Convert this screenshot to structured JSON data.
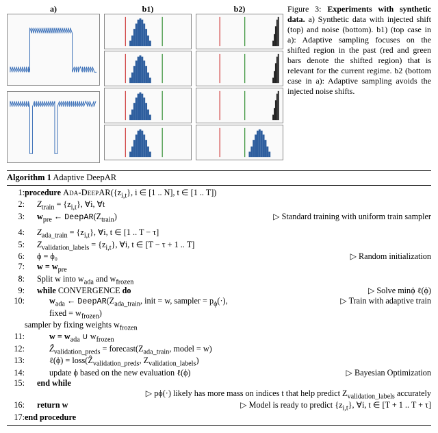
{
  "figure": {
    "labels": {
      "a": "a)",
      "b1": "b1)",
      "b2": "b2)"
    },
    "caption_prefix": "Figure 3:",
    "caption_title": "Experiments with synthetic data.",
    "caption_body": " a) Synthetic data with injected shift (top) and noise (bottom). b1) (top case in a): Adaptive sampling focuses on the shifted region in the past (red and green bars denote the shifted region) that is relevant for the current regime. b2 (bottom case in a): Adaptive sampling avoids the injected noise shifts."
  },
  "algorithm": {
    "title_prefix": "Algorithm 1",
    "title_name": "Adaptive DeepAR",
    "lines": {
      "l1_kw": "procedure",
      "l1_name": "Ada-DeepAR",
      "l1_args": "({z",
      "l1_args2": "i,t",
      "l1_args3": "},  i ∈ [1 .. N],  t ∈ [1 .. T])",
      "l2": "Z",
      "l2b": "train",
      "l2c": " = {z",
      "l2d": "i,t",
      "l2e": "}, ∀i,  ∀t",
      "l3a": "w",
      "l3b": "pre",
      "l3c": " ← ",
      "l3d": "DeepAR",
      "l3e": "(Z",
      "l3f": "train",
      "l3g": ")",
      "c3": "▷ Standard training with uniform train sampler",
      "l4a": "Z",
      "l4b": "ada_train",
      "l4c": " = {z",
      "l4d": "i,t",
      "l4e": "},  ∀i,  t ∈ [1 .. T − τ]",
      "l5a": "Z",
      "l5b": "validation_labels",
      "l5c": " = {z",
      "l5d": "i,t",
      "l5e": "},  ∀i,  t ∈ [T − τ + 1 .. T]",
      "l6": "ϕ = ϕ₀",
      "c6": "▷ Random initialization",
      "l7": "w = w",
      "l7b": "pre",
      "l8a": "Split w into w",
      "l8b": "ada",
      "l8c": " and w",
      "l8d": "frozen",
      "l9kw": "while",
      "l9": " CONVERGENCE ",
      "l9do": "do",
      "c9": "▷ Solve minϕ ℓ(ϕ)",
      "l10a": "w",
      "l10b": "ada",
      "l10c": " ← ",
      "l10d": "DeepAR",
      "l10e": "(Z",
      "l10f": "ada_train",
      "l10g": ", init = w, sampler = p",
      "l10h": "ϕ",
      "l10i": "(·), fixed = w",
      "l10j": "frozen",
      "l10k": ")",
      "c10line": "▷ Train with adaptive train",
      "c10cont": "sampler by fixing weights w",
      "c10cont2": "frozen",
      "l11a": "w = w",
      "l11b": "ada",
      "l11c": " ∪ w",
      "l11d": "frozen",
      "l12a": "Ẑ",
      "l12b": "validation_preds",
      "l12c": " = forecast(Z",
      "l12d": "ada_train",
      "l12e": ", model = w)",
      "l13a": "ℓ(ϕ) = loss(Ẑ",
      "l13b": "validation_preds",
      "l13c": ", Z",
      "l13d": "validation_labels",
      "l13e": ")",
      "l14": "update ϕ based on the new evaluation ℓ(ϕ)",
      "c14": "▷ Bayesian Optimization",
      "l15": "end while",
      "c15line": "▷ pϕ(·) likely has more mass on indices t that help predict Z",
      "c15line2": "validation_labels",
      "c15line3": " accurately",
      "l16": "return w",
      "c16a": "▷ Model is ready to predict {z",
      "c16b": "i,t",
      "c16c": "},  ∀i,  t ∈ [T + 1 .. T + τ]",
      "l17": "end procedure"
    }
  }
}
